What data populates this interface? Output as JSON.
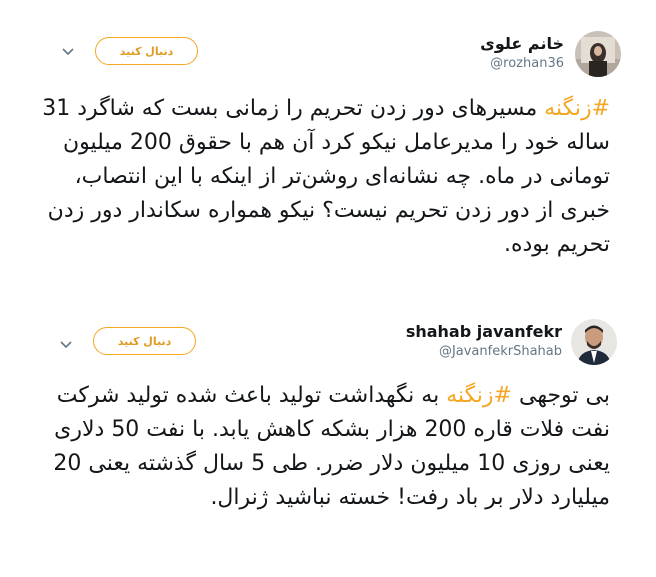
{
  "tweets": [
    {
      "display_name": "خانم علوی",
      "handle": "@rozhan36",
      "follow_label": "دنبال کنید",
      "hashtag": "#زنگنه",
      "text_rest": " مسیرهای دور زدن تحریم را زمانی بست که شاگرد 31 ساله خود را مدیرعامل نیکو کرد آن هم با حقوق 200 میلیون تومانی در ماه. چه نشانه‌ای روشن‌تر از اینکه با این انتصاب، خبری از دور زدن تحریم نیست؟ نیکو همواره سکاندار دور زدن تحریم بوده."
    },
    {
      "display_name": "shahab javanfekr",
      "handle": "@JavanfekrShahab",
      "follow_label": "دنبال کنید",
      "text_before": "بی توجهی ",
      "hashtag": "#زنگنه",
      "text_after": " به نگهداشت تولید باعث شده تولید شرکت نفت فلات قاره 200 هزار بشکه کاهش یابد. با نفت 50 دلاری یعنی روزی 10 میلیون دلار ضرر. طی 5 سال گذشته یعنی 20 میلیارد دلار بر باد رفت! خسته نباشید ژنرال."
    }
  ],
  "colors": {
    "accent": "#f5a623",
    "text": "#14171a",
    "muted": "#657786"
  },
  "icons": [
    "avatar-photo",
    "chevron-down-icon"
  ]
}
